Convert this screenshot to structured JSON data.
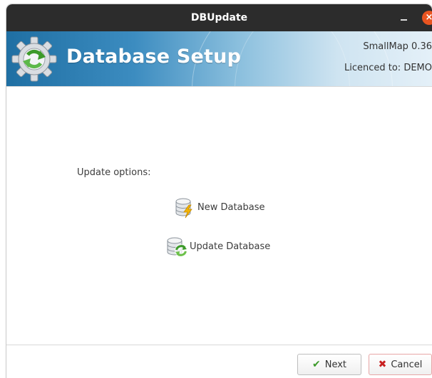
{
  "window": {
    "title": "DBUpdate",
    "minimize_glyph": "–",
    "close_glyph": "×"
  },
  "banner": {
    "title": "Database Setup",
    "version": "SmallMap 0.36",
    "licence": "Licenced to: DEMO",
    "icon": "gear-refresh-icon"
  },
  "content": {
    "options_label": "Update options:",
    "options": [
      {
        "label": "New Database",
        "icon": "database-lightning-icon"
      },
      {
        "label": "Update Database",
        "icon": "database-refresh-icon"
      }
    ]
  },
  "footer": {
    "next_label": "Next",
    "next_icon": "check-icon",
    "cancel_label": "Cancel",
    "cancel_icon": "x-icon"
  },
  "colors": {
    "titlebar": "#2c2c2c",
    "close_button": "#e95420",
    "banner_start": "#1f6fa3",
    "banner_end": "#e4f0f8",
    "check": "#3c9a2a",
    "cancel_x": "#c82020"
  }
}
